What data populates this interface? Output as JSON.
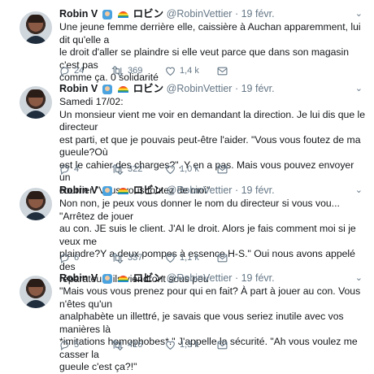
{
  "tweets": [
    {
      "name": "Robin V",
      "alt_name": "ロビン",
      "handle": "@RobinVettier",
      "date": "19 févr.",
      "lines": [
        "Une jeune femme derrière elle, caissière à Auchan apparemment, lui dit qu'elle a",
        "le droit d'aller se plaindre si elle veut parce que dans son magasin c'est pas",
        "comme ça. 0 solidarité"
      ],
      "replies": "24",
      "retweets": "369",
      "likes": "1,4 k"
    },
    {
      "name": "Robin V",
      "alt_name": "ロビン",
      "handle": "@RobinVettier",
      "date": "19 févr.",
      "lines": [
        "Samedi 17/02:",
        "Un monsieur vient me voir en demandant la direction. Je lui dis que le directeur",
        "est parti, et que je pouvais peut-être l'aider. \"Vous vous foutez de ma gueule?Où",
        "est le cahier des charges?\". Y en a pas. Mais vous pouvez envoyer un",
        "courrier.\"Vous vous foutez de moi\""
      ],
      "replies": "4",
      "retweets": "322",
      "likes": "1,0 k"
    },
    {
      "name": "Robin V",
      "alt_name": "ロビン",
      "handle": "@RobinVettier",
      "date": "19 févr.",
      "lines": [
        "Non non, je peux vous donner le nom du directeur si vous vou... \"Arrêtez de jouer",
        "au con. JE suis le client. J'AI le droit. Alors je fais comment moi si je veux me",
        "plaindre?Y a deux pompes à essence H-S.\" Oui nous avons appelé des",
        "réparateurs ils viendront sous peu"
      ],
      "replies": "6",
      "retweets": "337",
      "likes": "1,1 k"
    },
    {
      "name": "Robin V",
      "alt_name": "ロビン",
      "handle": "@RobinVettier",
      "date": "19 févr.",
      "lines": [
        "\"Mais vous vous prenez pour qui en fait? À part à jouer au con. Vous n'êtes qu'un",
        "analphabète un illettré, je savais que vous seriez inutile avec vos manières là",
        "*imitations homophobes*.\" J'appelle la sécurité. \"Ah vous voulez me casser la",
        "gueule c'est ça?!\""
      ],
      "replies": "5",
      "retweets": "416",
      "likes": "1,3 k"
    }
  ]
}
